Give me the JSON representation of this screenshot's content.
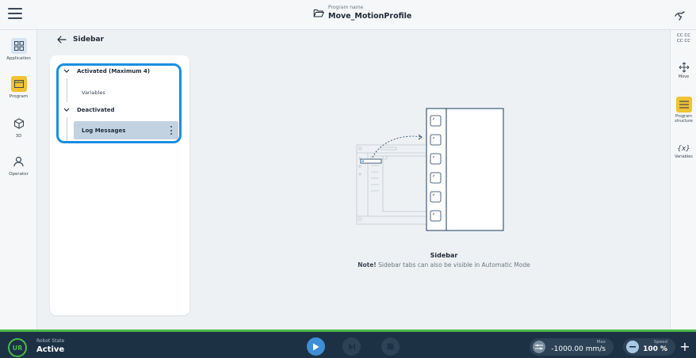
{
  "topbar": {
    "program_label": "Program name",
    "program_name": "Move_MotionProfile",
    "menu_icon": "hamburger-menu-icon",
    "folder_icon": "folder-open-icon",
    "right_icon": "robot-hand-icon"
  },
  "leftnav": {
    "items": [
      {
        "label": "Application",
        "icon": "grid-icon"
      },
      {
        "label": "Program",
        "icon": "program-window-icon"
      },
      {
        "label": "3D",
        "icon": "cube-icon"
      },
      {
        "label": "Operator",
        "icon": "user-icon"
      }
    ]
  },
  "rightbar": {
    "cc_line1": "CC CC",
    "cc_line2": "CC CC",
    "move_label": "Move",
    "structure_label_1": "Program",
    "structure_label_2": "structure",
    "variables_symbol": "{x}",
    "variables_label": "Variables"
  },
  "main": {
    "back_title": "Sidebar",
    "tree": {
      "activated_label": "Activated (Maximum 4)",
      "activated_items": [
        "Variables"
      ],
      "deactivated_label": "Deactivated",
      "deactivated_items": [
        "Log Messages"
      ]
    },
    "illustration": {
      "title": "Sidebar",
      "note_bold": "Note!",
      "note_text": " Sidebar tabs can also be visible in Automatic Mode"
    }
  },
  "footer": {
    "logo_text": "UR",
    "robot_state_label": "Robot State",
    "robot_state_value": "Active",
    "max_label": "Max",
    "max_value": "-1000.00 mm/s",
    "speed_label": "Speed",
    "speed_value": "100 %",
    "plus_label": "+"
  },
  "colors": {
    "accent_blue": "#1b8fe0",
    "program_yellow": "#f2c230",
    "footer_bg": "#1d3145",
    "status_green": "#4cb84a"
  }
}
